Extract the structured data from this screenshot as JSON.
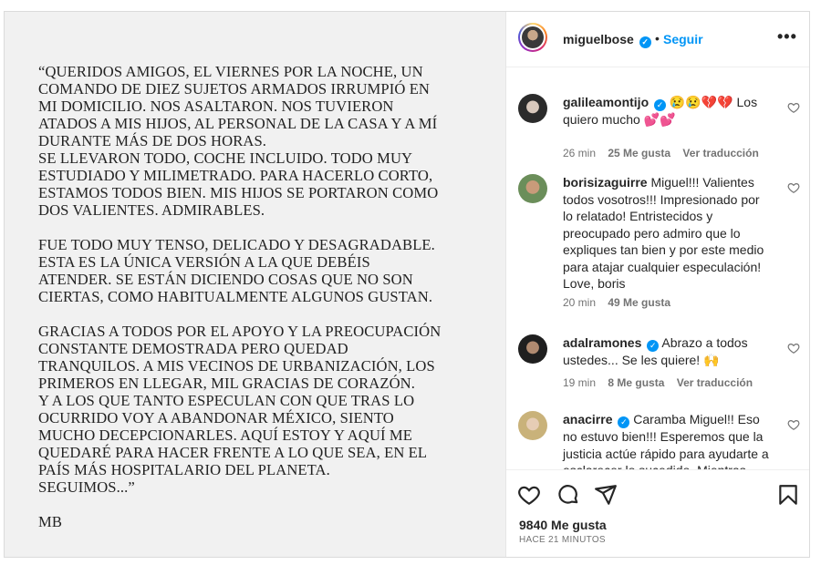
{
  "post": {
    "paragraphs": [
      "“QUERIDOS AMIGOS, EL VIERNES POR LA NOCHE, UN\nCOMANDO DE DIEZ SUJETOS ARMADOS IRRUMPIÓ EN\nMI DOMICILIO. NOS ASALTARON. NOS TUVIERON\nATADOS A MIS HIJOS, AL PERSONAL DE LA CASA Y A MÍ\nDURANTE MÁS DE DOS HORAS.\nSE LLEVARON TODO, COCHE INCLUIDO. TODO MUY\nESTUDIADO Y MILIMETRADO. PARA HACERLO CORTO,\nESTAMOS TODOS BIEN. MIS HIJOS SE PORTARON COMO\nDOS VALIENTES. ADMIRABLES.",
      "FUE TODO MUY TENSO, DELICADO Y DESAGRADABLE.\nESTA ES LA ÚNICA VERSIÓN A LA QUE DEBÉIS\nATENDER. SE ESTÁN DICIENDO COSAS QUE NO SON\nCIERTAS, COMO HABITUALMENTE ALGUNOS GUSTAN.",
      "GRACIAS A TODOS POR EL APOYO Y LA PREOCUPACIÓN\nCONSTANTE DEMOSTRADA PERO QUEDAD\nTRANQUILOS. A MIS VECINOS DE URBANIZACIÓN, LOS\nPRIMEROS EN LLEGAR, MIL GRACIAS DE CORAZÓN.\nY A LOS QUE TANTO ESPECULAN CON QUE TRAS LO\nOCURRIDO VOY A ABANDONAR MÉXICO, SIENTO\nMUCHO DECEPCIONARLES. AQUÍ ESTOY Y AQUÍ ME\nQUEDARÉ PARA HACER FRENTE A LO QUE SEA, EN EL\nPAÍS MÁS HOSPITALARIO DEL PLANETA.\nSEGUIMOS...”",
      "MB"
    ]
  },
  "header": {
    "username": "miguelbose",
    "verified_glyph": "✓",
    "separator": "•",
    "follow_label": "Seguir",
    "more_glyph": "•••"
  },
  "comments": [
    {
      "user": "galileamontijo",
      "verified": true,
      "text": "😢😢💔💔 Los quiero mucho 💕💕",
      "time": "26 min",
      "likes": "25 Me gusta",
      "translate": "Ver traducción"
    },
    {
      "user": "borisizaguirre",
      "verified": false,
      "text": "Miguel!!! Valientes todos vosotros!!! Impresionado por lo relatado! Entristecidos y preocupado pero admiro que lo expliques tan bien y por este medio para atajar cualquier especulación! Love, boris",
      "time": "20 min",
      "likes": "49 Me gusta",
      "translate": ""
    },
    {
      "user": "adalramones",
      "verified": true,
      "text": "Abrazo a todos ustedes... Se les quiere! 🙌",
      "time": "19 min",
      "likes": "8 Me gusta",
      "translate": "Ver traducción"
    },
    {
      "user": "anacirre",
      "verified": true,
      "text": "Caramba Miguel!! Eso no estuvo bien!!! Esperemos que la justicia actúe rápido para ayudarte a esclarecer lo sucedido. Mientras",
      "time": "",
      "likes": "",
      "translate": ""
    }
  ],
  "footer": {
    "likes": "9840 Me gusta",
    "time": "HACE 21 MINUTOS"
  },
  "colors": {
    "accent": "#0095f6",
    "text": "#262626",
    "muted": "#737373"
  }
}
